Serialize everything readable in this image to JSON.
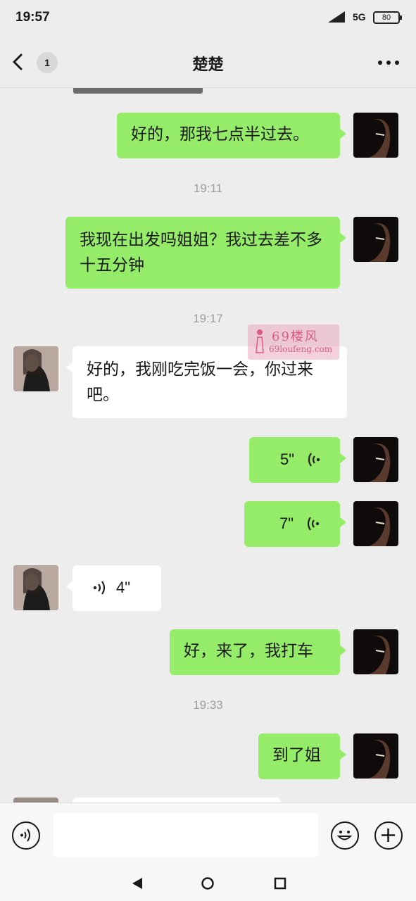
{
  "status_bar": {
    "time": "19:57",
    "network": "5G",
    "battery": "80"
  },
  "header": {
    "title": "楚楚",
    "unread_count": "1"
  },
  "messages": [
    {
      "side": "right",
      "type": "text",
      "text": "好的，那我七点半过去。"
    },
    {
      "type": "timestamp",
      "text": "19:11"
    },
    {
      "side": "right",
      "type": "text",
      "text": "我现在出发吗姐姐？我过去差不多十五分钟"
    },
    {
      "type": "timestamp",
      "text": "19:17"
    },
    {
      "side": "left",
      "type": "text",
      "text": "好的，我刚吃完饭一会，你过来吧。"
    },
    {
      "side": "right",
      "type": "voice",
      "duration": "5\""
    },
    {
      "side": "right",
      "type": "voice",
      "duration": "7\""
    },
    {
      "side": "left",
      "type": "voice",
      "duration": "4\""
    },
    {
      "side": "right",
      "type": "text",
      "text": "好，来了，我打车"
    },
    {
      "type": "timestamp",
      "text": "19:33"
    },
    {
      "side": "right",
      "type": "text",
      "text": "到了姐"
    }
  ],
  "watermark": {
    "line1": "69楼风",
    "line2": "69loufeng.com"
  },
  "icons": {
    "back": "chevron-left-icon",
    "more": "more-dots-icon",
    "voice_toggle": "voice-icon",
    "emoji": "emoji-icon",
    "plus": "plus-icon",
    "nav_back": "triangle-back-icon",
    "nav_home": "circle-home-icon",
    "nav_recents": "square-recents-icon"
  },
  "colors": {
    "background": "#ededed",
    "sent_bubble": "#95ec69",
    "received_bubble": "#ffffff",
    "timestamp": "#9e9e9e",
    "watermark": "#d85c86"
  }
}
